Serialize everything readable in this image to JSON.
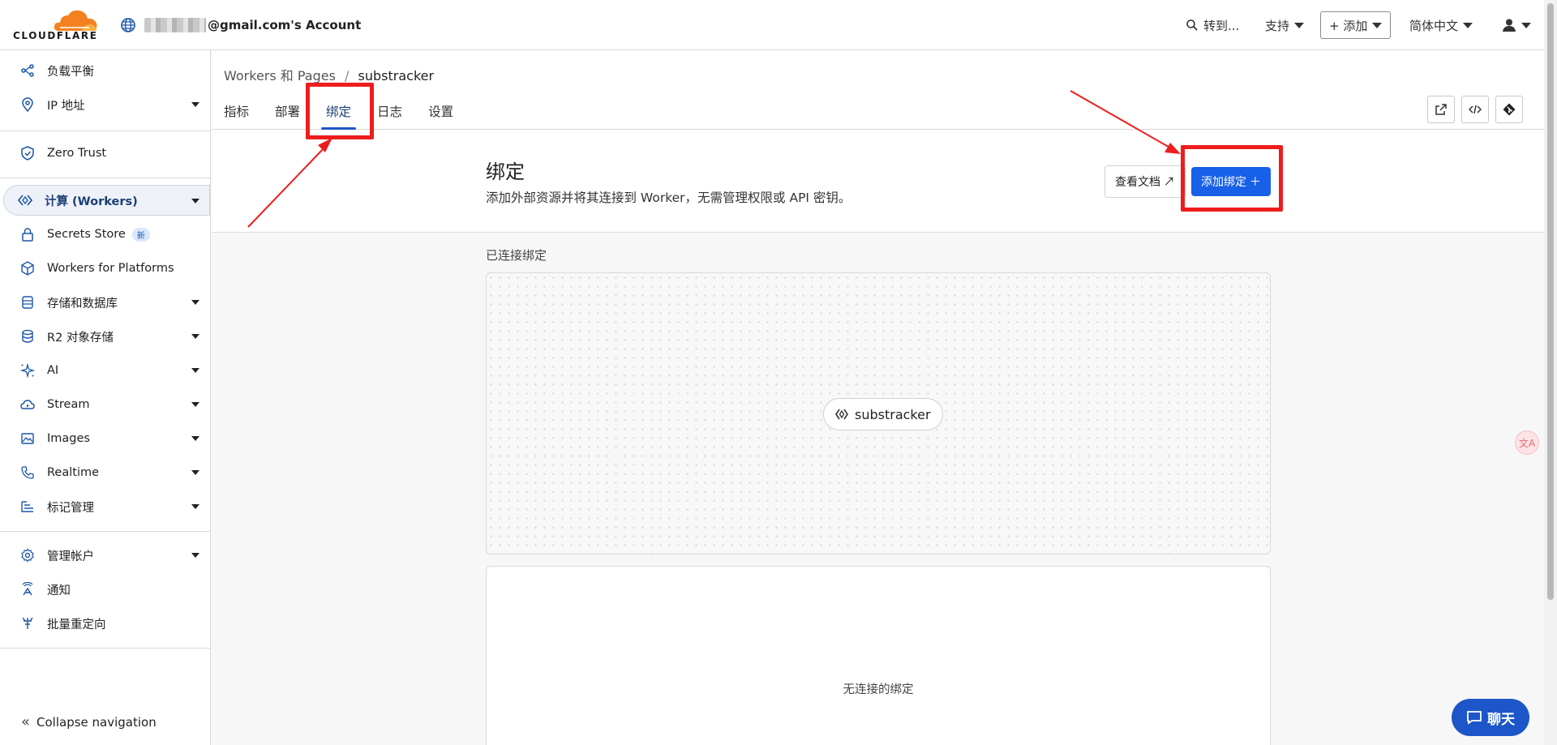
{
  "header": {
    "logo_text": "CLOUDFLARE",
    "account_label": "@gmail.com's Account",
    "search_label": "转到...",
    "support_label": "支持",
    "add_label": "+ 添加",
    "language_label": "简体中文"
  },
  "sidebar": {
    "items": [
      {
        "label": "负载平衡",
        "icon": "load-balancing-icon"
      },
      {
        "label": "IP 地址",
        "icon": "location-pin-icon"
      },
      {
        "label": "Zero Trust",
        "icon": "zero-trust-icon"
      },
      {
        "label": "计算 (Workers)",
        "icon": "workers-icon"
      },
      {
        "label": "Secrets Store",
        "icon": "lock-icon",
        "badge": "新"
      },
      {
        "label": "Workers for Platforms",
        "icon": "cube-icon"
      },
      {
        "label": "存储和数据库",
        "icon": "database-icon"
      },
      {
        "label": "R2 对象存储",
        "icon": "storage-icon"
      },
      {
        "label": "AI",
        "icon": "ai-sparkle-icon"
      },
      {
        "label": "Stream",
        "icon": "stream-cloud-icon"
      },
      {
        "label": "Images",
        "icon": "image-icon"
      },
      {
        "label": "Realtime",
        "icon": "phone-icon"
      },
      {
        "label": "标记管理",
        "icon": "tag-manager-icon"
      },
      {
        "label": "管理帐户",
        "icon": "gear-icon"
      },
      {
        "label": "通知",
        "icon": "antenna-icon"
      },
      {
        "label": "批量重定向",
        "icon": "redirect-icon"
      }
    ],
    "collapse_label": "Collapse navigation"
  },
  "main": {
    "breadcrumb_parent": "Workers 和 Pages",
    "breadcrumb_sep": "/",
    "breadcrumb_current": "substracker",
    "tabs": [
      "指标",
      "部署",
      "绑定",
      "日志",
      "设置"
    ],
    "section_title": "绑定",
    "section_desc": "添加外部资源并将其连接到 Worker，无需管理权限或 API 密钥。",
    "docs_button": "查看文档 ↗",
    "add_binding_button": "添加绑定 ＋",
    "connected_label": "已连接绑定",
    "worker_name": "substracker",
    "empty_text": "无连接的绑定"
  },
  "chat": {
    "label": "聊天"
  },
  "translate": {
    "label": "文A"
  },
  "colors": {
    "accent": "#1760e8",
    "annotation": "#ee1d1d",
    "logo_orange": "#f48120"
  }
}
